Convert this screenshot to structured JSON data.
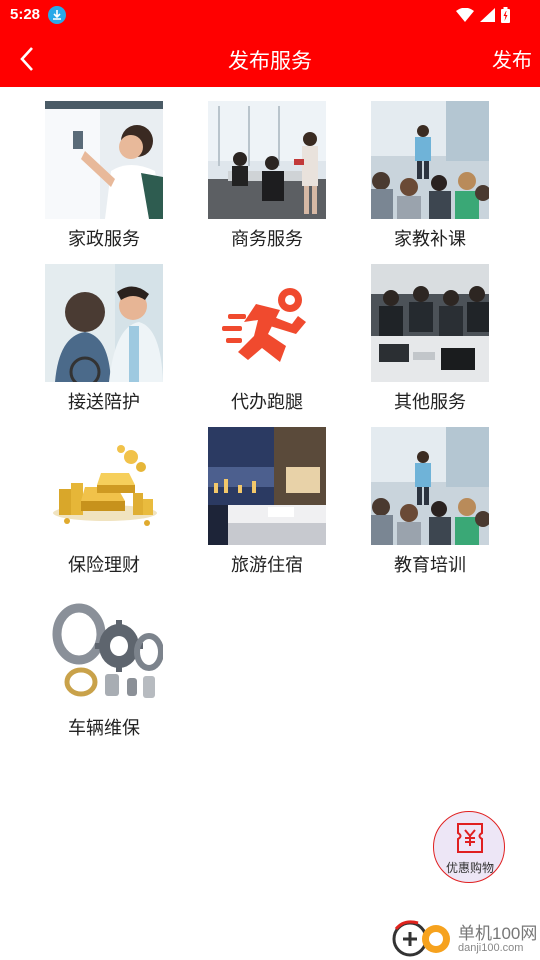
{
  "status_bar": {
    "time": "5:28"
  },
  "header": {
    "back_icon": "chevron-left-icon",
    "title": "发布服务",
    "action_label": "发布"
  },
  "colors": {
    "brand_red": "#ff0000",
    "fab_bg": "#ede6f6"
  },
  "services": [
    {
      "label": "家政服务"
    },
    {
      "label": "商务服务"
    },
    {
      "label": "家教补课"
    },
    {
      "label": "接送陪护"
    },
    {
      "label": "代办跑腿"
    },
    {
      "label": "其他服务"
    },
    {
      "label": "保险理财"
    },
    {
      "label": "旅游住宿"
    },
    {
      "label": "教育培训"
    },
    {
      "label": "车辆维保"
    }
  ],
  "fab": {
    "icon": "yen-ticket-icon",
    "label": "优惠购物"
  },
  "watermark": {
    "brand": "单机100网",
    "url": "danji100.com"
  }
}
